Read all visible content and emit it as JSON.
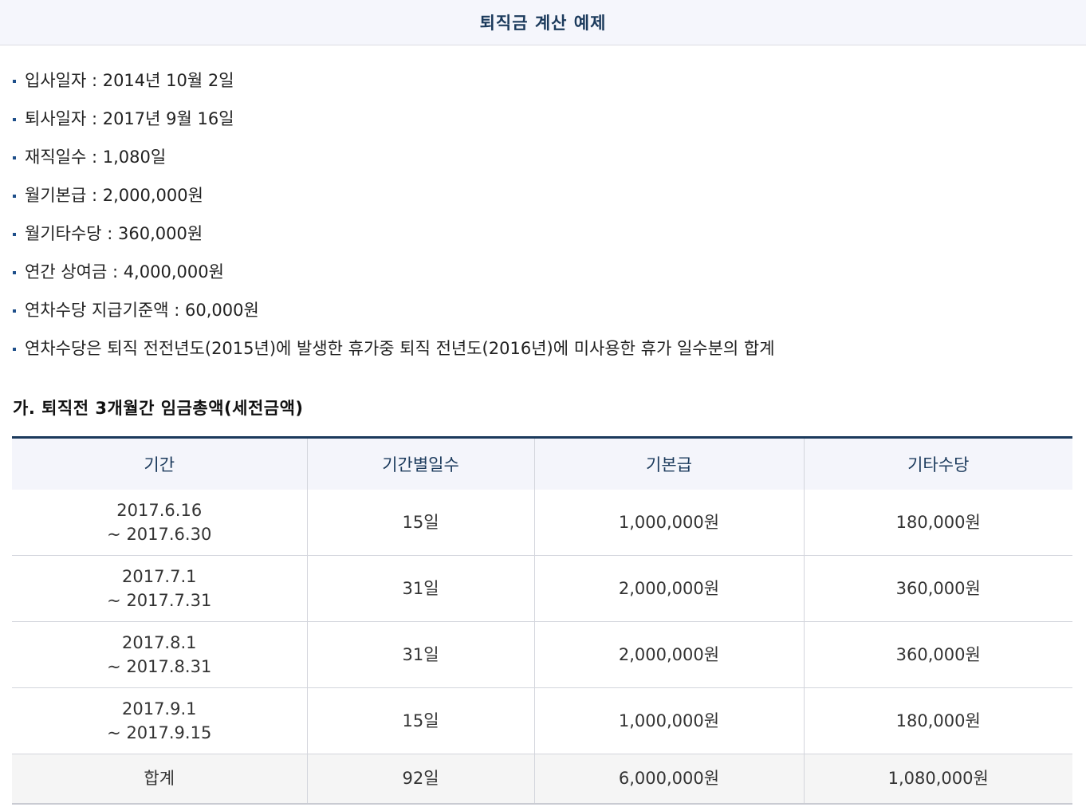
{
  "header": {
    "title": "퇴직금 계산 예제"
  },
  "facts": [
    "입사일자 : 2014년 10월 2일",
    "퇴사일자 : 2017년 9월 16일",
    "재직일수 : 1,080일",
    "월기본급 : 2,000,000원",
    "월기타수당 : 360,000원",
    "연간 상여금 : 4,000,000원",
    "연차수당 지급기준액 : 60,000원",
    "연차수당은 퇴직 전전년도(2015년)에 발생한 휴가중 퇴직 전년도(2016년)에 미사용한 휴가 일수분의 합계"
  ],
  "section": {
    "title": "가. 퇴직전 3개월간 임금총액(세전금액)"
  },
  "table": {
    "headers": [
      "기간",
      "기간별일수",
      "기본급",
      "기타수당"
    ],
    "rows": [
      {
        "start": "2017.6.16",
        "end": "~ 2017.6.30",
        "days": "15일",
        "base": "1,000,000원",
        "other": "180,000원"
      },
      {
        "start": "2017.7.1",
        "end": "~ 2017.7.31",
        "days": "31일",
        "base": "2,000,000원",
        "other": "360,000원"
      },
      {
        "start": "2017.8.1",
        "end": "~ 2017.8.31",
        "days": "31일",
        "base": "2,000,000원",
        "other": "360,000원"
      },
      {
        "start": "2017.9.1",
        "end": "~ 2017.9.15",
        "days": "15일",
        "base": "1,000,000원",
        "other": "180,000원"
      }
    ],
    "total": {
      "label": "합계",
      "days": "92일",
      "base": "6,000,000원",
      "other": "1,080,000원"
    }
  }
}
